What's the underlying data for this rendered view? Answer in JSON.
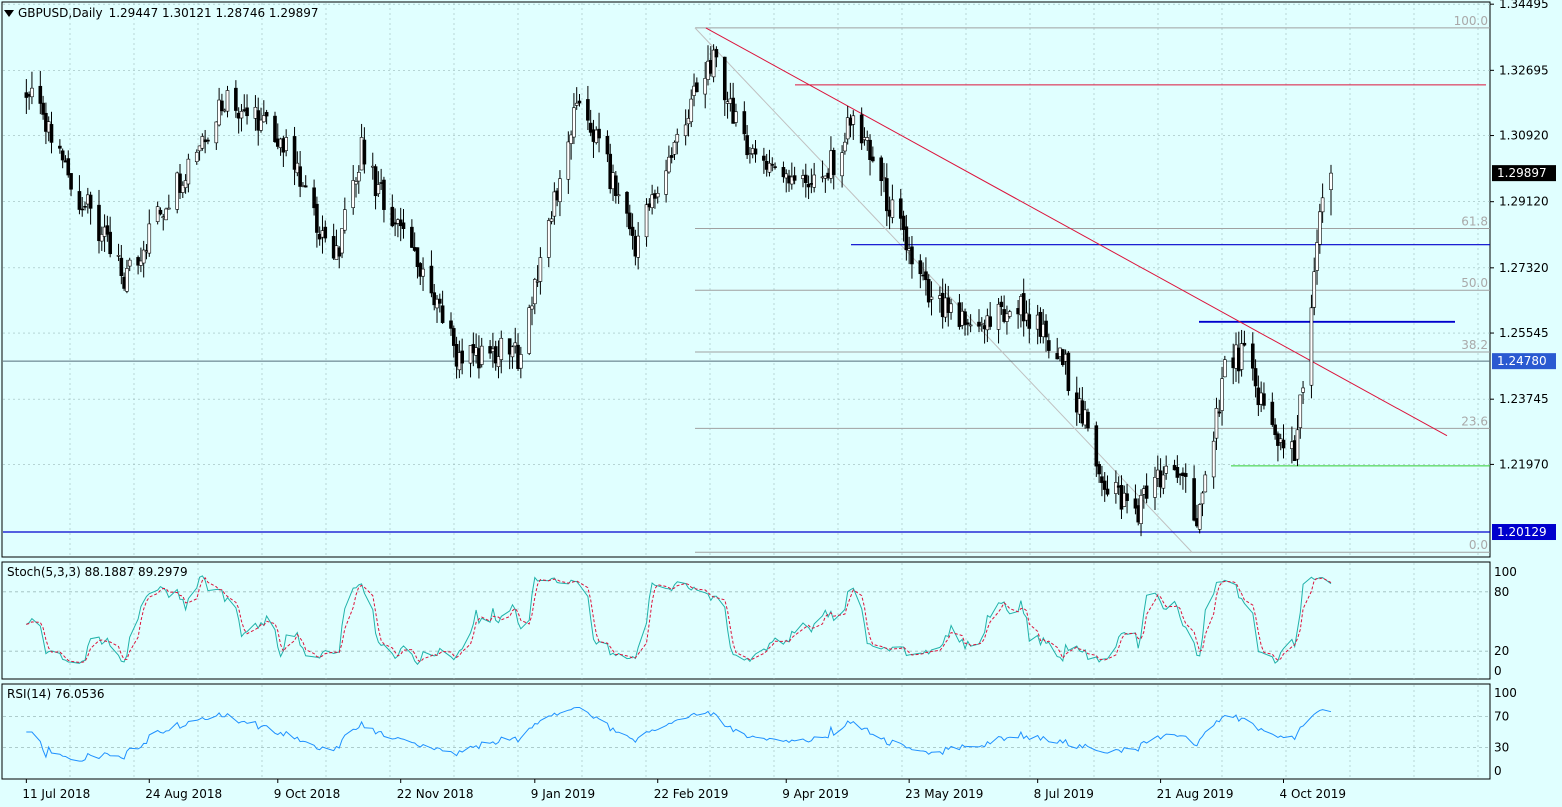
{
  "header": {
    "symbol": "GBPUSD,Daily",
    "ohlc": "1.29447 1.30121 1.28746 1.29897"
  },
  "colors": {
    "background": "#e0ffff",
    "bull": "#ffffff",
    "bear": "#000000",
    "trendline": "#dc143c",
    "resistance_red": "#dc143c",
    "support_blue": "#0000cd",
    "green_level": "#32cd32",
    "fib": "#a0a0a0",
    "stoch_main": "#20b2aa",
    "stoch_signal": "#dc143c",
    "rsi": "#1e90ff",
    "price_tag_bg": "#000000",
    "level_tag_bg": "#2a5ad1",
    "level_tag_dark": "#0000cd"
  },
  "price_axis": {
    "ticks": [
      "1.34495",
      "1.32695",
      "1.30920",
      "1.29120",
      "1.27320",
      "1.25545",
      "1.23745",
      "1.21970"
    ],
    "current_price_tag": "1.29897",
    "level_tag_upper": "1.24780",
    "level_tag_lower": "1.20129"
  },
  "date_axis": [
    "11 Jul 2018",
    "24 Aug 2018",
    "9 Oct 2018",
    "22 Nov 2018",
    "9 Jan 2019",
    "22 Feb 2019",
    "9 Apr 2019",
    "23 May 2019",
    "8 Jul 2019",
    "21 Aug 2019",
    "4 Oct 2019"
  ],
  "fibonacci": {
    "levels": [
      {
        "label": "100.0",
        "price": 1.3385
      },
      {
        "label": "61.8",
        "price": 1.2839
      },
      {
        "label": "50.0",
        "price": 1.2671
      },
      {
        "label": "38.2",
        "price": 1.2503
      },
      {
        "label": "23.6",
        "price": 1.2295
      },
      {
        "label": "0.0",
        "price": 1.1958
      }
    ]
  },
  "stochastic": {
    "title": "Stoch(5,3,3) 88.1887 89.2979",
    "main": 88.1887,
    "signal": 89.2979,
    "ticks": [
      "100",
      "80",
      "20",
      "0"
    ]
  },
  "rsi": {
    "title": "RSI(14) 76.0536",
    "value": 76.0536,
    "ticks": [
      "100",
      "70",
      "30",
      "0"
    ]
  },
  "chart_data": {
    "type": "candlestick",
    "symbol": "GBPUSD",
    "timeframe": "Daily",
    "ylim": [
      1.1945,
      1.345
    ],
    "last_ohlc": {
      "open": 1.29447,
      "high": 1.30121,
      "low": 1.28746,
      "close": 1.29897
    },
    "key_closes": [
      {
        "date": "2018-07-11",
        "close": 1.321
      },
      {
        "date": "2018-08-15",
        "close": 1.27
      },
      {
        "date": "2018-09-20",
        "close": 1.32
      },
      {
        "date": "2018-10-09",
        "close": 1.31
      },
      {
        "date": "2018-10-30",
        "close": 1.275
      },
      {
        "date": "2018-11-08",
        "close": 1.305
      },
      {
        "date": "2018-12-12",
        "close": 1.25
      },
      {
        "date": "2019-01-03",
        "close": 1.25
      },
      {
        "date": "2019-01-25",
        "close": 1.32
      },
      {
        "date": "2019-02-14",
        "close": 1.28
      },
      {
        "date": "2019-03-13",
        "close": 1.33
      },
      {
        "date": "2019-03-29",
        "close": 1.303
      },
      {
        "date": "2019-04-22",
        "close": 1.296
      },
      {
        "date": "2019-05-03",
        "close": 1.314
      },
      {
        "date": "2019-05-31",
        "close": 1.263
      },
      {
        "date": "2019-06-17",
        "close": 1.256
      },
      {
        "date": "2019-07-01",
        "close": 1.264
      },
      {
        "date": "2019-07-18",
        "close": 1.246
      },
      {
        "date": "2019-08-01",
        "close": 1.215
      },
      {
        "date": "2019-08-12",
        "close": 1.207
      },
      {
        "date": "2019-08-20",
        "close": 1.215
      },
      {
        "date": "2019-08-29",
        "close": 1.218
      },
      {
        "date": "2019-09-03",
        "close": 1.2
      },
      {
        "date": "2019-09-13",
        "close": 1.247
      },
      {
        "date": "2019-09-20",
        "close": 1.25
      },
      {
        "date": "2019-09-30",
        "close": 1.229
      },
      {
        "date": "2019-10-08",
        "close": 1.221
      },
      {
        "date": "2019-10-14",
        "close": 1.263
      },
      {
        "date": "2019-10-17",
        "close": 1.286
      },
      {
        "date": "2019-10-21",
        "close": 1.29897
      }
    ],
    "horizontal_levels": [
      {
        "price": 1.323,
        "color": "red"
      },
      {
        "price": 1.2795,
        "color": "blue"
      },
      {
        "price": 1.2585,
        "color": "blue"
      },
      {
        "price": 1.2478,
        "color": "gray"
      },
      {
        "price": 1.2193,
        "color": "green"
      },
      {
        "price": 1.2013,
        "color": "blue"
      }
    ],
    "trendline": {
      "from": {
        "date": "2019-03-13",
        "price": 1.3385
      },
      "to": {
        "date": "2019-11-14",
        "price": 1.2275
      }
    }
  }
}
